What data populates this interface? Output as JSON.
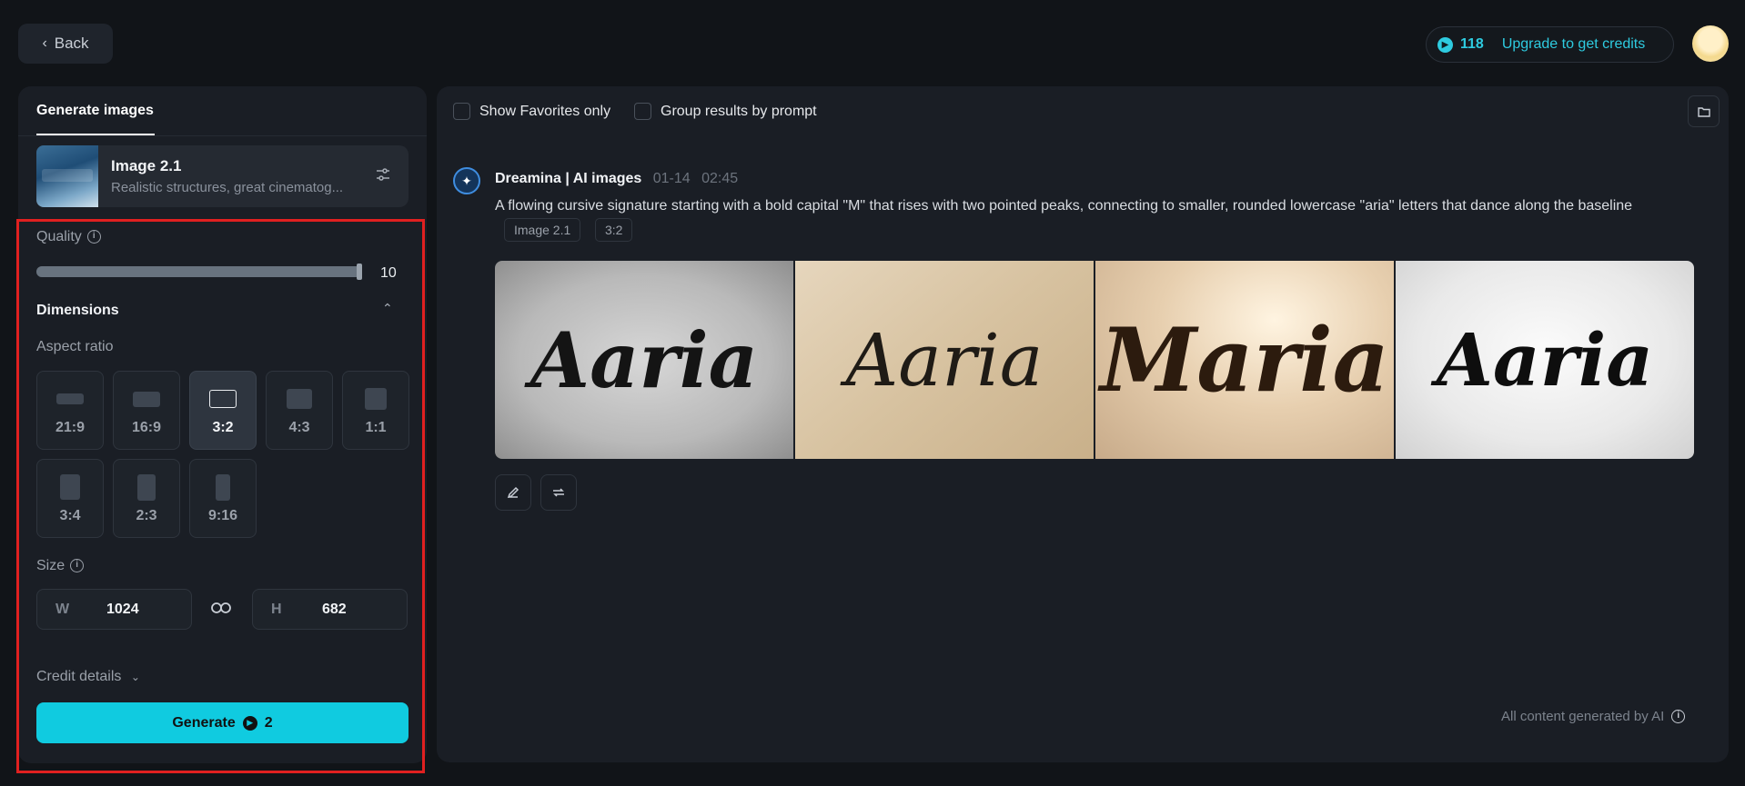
{
  "header": {
    "back_label": "Back",
    "credits": "118",
    "upgrade_label": "Upgrade to get credits"
  },
  "left_panel": {
    "tab_label": "Generate images",
    "model": {
      "name": "Image 2.1",
      "description": "Realistic structures, great cinematog..."
    },
    "quality": {
      "label": "Quality",
      "value": "10",
      "fraction": 0.99
    },
    "dimensions": {
      "title": "Dimensions",
      "aspect_label": "Aspect ratio",
      "ratios": [
        "21:9",
        "16:9",
        "3:2",
        "4:3",
        "1:1",
        "3:4",
        "2:3",
        "9:16"
      ],
      "selected_ratio": "3:2"
    },
    "size": {
      "label": "Size",
      "width_prefix": "W",
      "width": "1024",
      "height_prefix": "H",
      "height": "682"
    },
    "credit_details_label": "Credit details",
    "generate": {
      "label": "Generate",
      "cost": "2"
    }
  },
  "right_panel": {
    "show_favorites_label": "Show Favorites only",
    "group_results_label": "Group results by prompt",
    "result": {
      "author": "Dreamina | AI images",
      "date": "01-14",
      "time": "02:45",
      "prompt": "A flowing cursive signature starting with a bold capital \"M\" that rises with two pointed peaks, connecting to smaller, rounded lowercase \"aria\" letters that dance along the baseline",
      "tags": [
        "Image 2.1",
        "3:2"
      ],
      "images": [
        "Aaria",
        "Aaria",
        "Maria",
        "Aaria"
      ]
    },
    "ai_note": "All content generated by AI"
  },
  "colors": {
    "accent": "#10cbe0",
    "highlight": "#e02020"
  }
}
